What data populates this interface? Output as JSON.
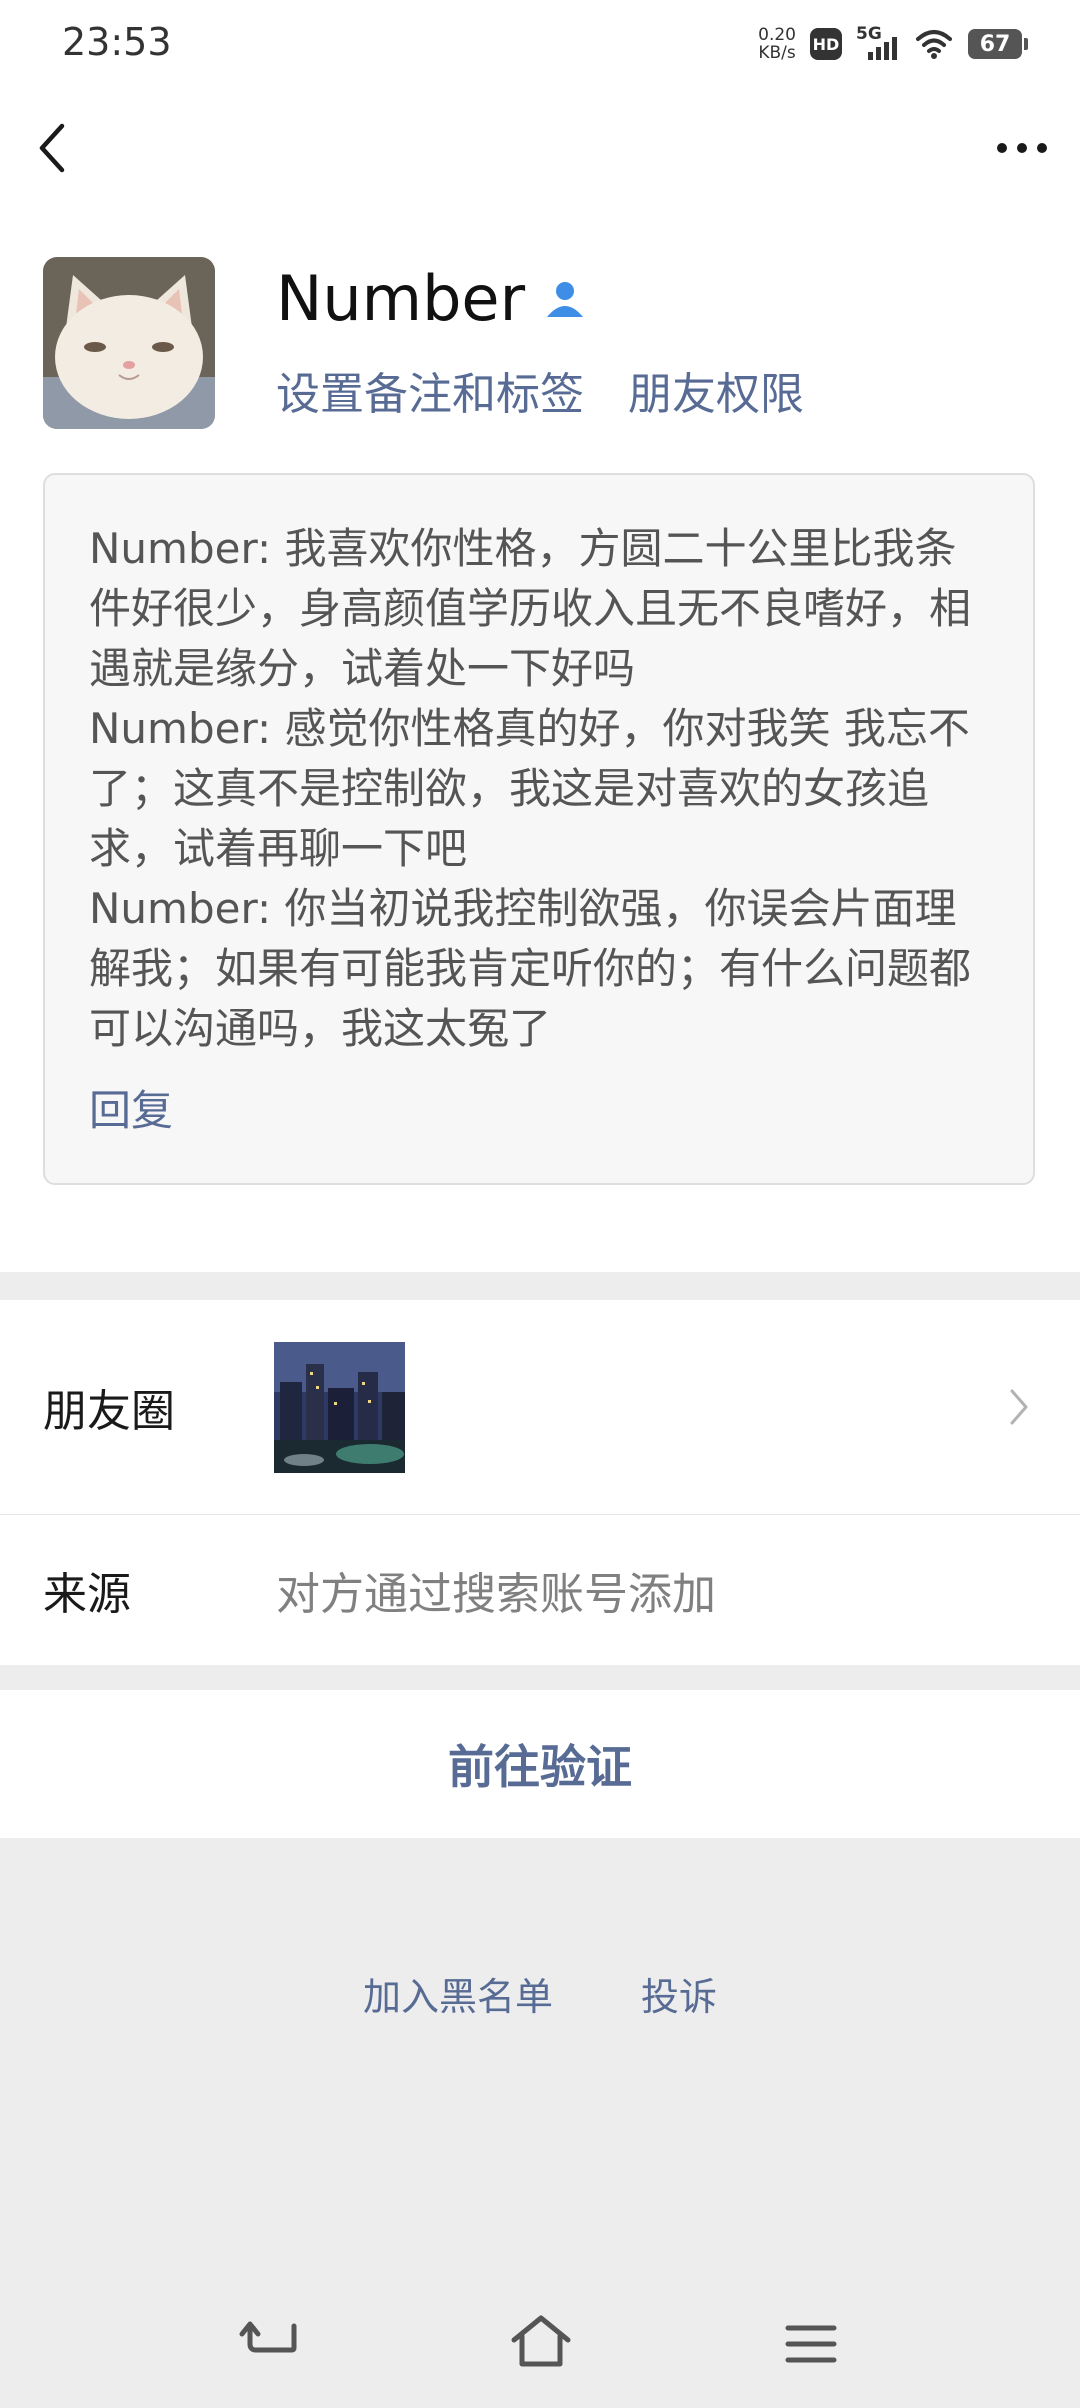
{
  "status_bar": {
    "time": "23:53",
    "net_speed_value": "0.20",
    "net_speed_unit": "KB/s",
    "hd": "HD",
    "network": "5G",
    "battery": "67"
  },
  "profile": {
    "name": "Number",
    "set_remark_label": "设置备注和标签",
    "friend_permissions_label": "朋友权限"
  },
  "message": {
    "lines": [
      "Number: 我喜欢你性格，方圆二十公里比我条件好很少，身高颜值学历收入且无不良嗜好，相遇就是缘分，试着处一下好吗",
      "Number: 感觉你性格真的好，你对我笑 我忘不了；这真不是控制欲，我这是对喜欢的女孩追求，试着再聊一下吧",
      "Number: 你当初说我控制欲强，你误会片面理解我；如果有可能我肯定听你的；有什么问题都可以沟通吗，我这太冤了"
    ],
    "reply_label": "回复"
  },
  "list": {
    "moments_label": "朋友圈",
    "source_label": "来源",
    "source_value": "对方通过搜索账号添加"
  },
  "verify_label": "前往验证",
  "bottom_links": {
    "blacklist": "加入黑名单",
    "report": "投诉"
  },
  "icons": {
    "back": "back-arrow-icon",
    "more": "more-dots-icon",
    "contact": "contact-person-icon",
    "chevron": "chevron-right-icon"
  },
  "colors": {
    "link": "#576b95",
    "contact_icon": "#3e8ee8"
  }
}
